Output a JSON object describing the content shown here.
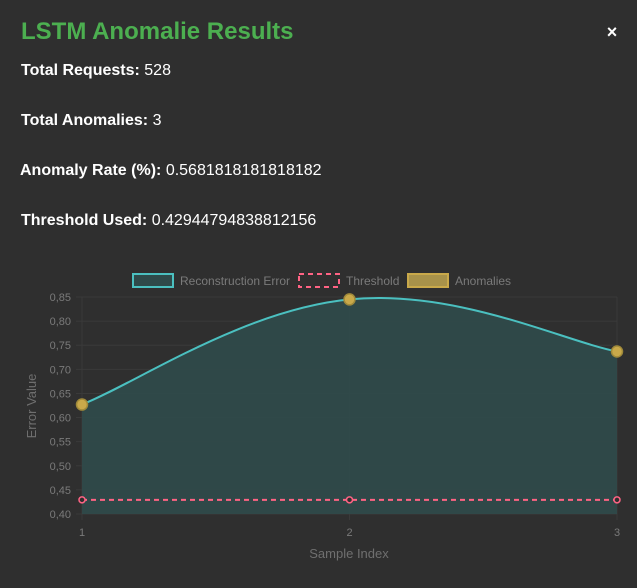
{
  "modal": {
    "title": "LSTM Anomalie Results",
    "close_label": "×",
    "stats": [
      {
        "key": "Total Requests:",
        "value": "528"
      },
      {
        "key": "Total Anomalies:",
        "value": "3"
      },
      {
        "key": "Anomaly Rate (%):",
        "value": "0.5681818181818182"
      },
      {
        "key": "Threshold Used:",
        "value": "0.42944794838812156"
      }
    ]
  },
  "colors": {
    "title": "#4caf50",
    "line": "#4bc0c0",
    "fill": "#2f4a4a",
    "threshold": "#ff6384",
    "anomaly_fill": "#c9a94a",
    "anomaly_stroke": "#a08a3a"
  },
  "chart_data": {
    "type": "line",
    "x": [
      1,
      2,
      3
    ],
    "categories": [
      "1",
      "2",
      "3"
    ],
    "series": [
      {
        "name": "Reconstruction Error",
        "values": [
          0.627,
          0.845,
          0.737
        ]
      },
      {
        "name": "Threshold",
        "values": [
          0.4294,
          0.4294,
          0.4294
        ]
      },
      {
        "name": "Anomalies",
        "values": [
          0.627,
          0.845,
          0.737
        ]
      }
    ],
    "xlabel": "Sample Index",
    "ylabel": "Error Value",
    "ylim": [
      0.4,
      0.85
    ],
    "yticks": [
      "0,85",
      "0,80",
      "0,75",
      "0,70",
      "0,65",
      "0,60",
      "0,55",
      "0,50",
      "0,45",
      "0,40"
    ],
    "grid": true,
    "legend": "top"
  }
}
